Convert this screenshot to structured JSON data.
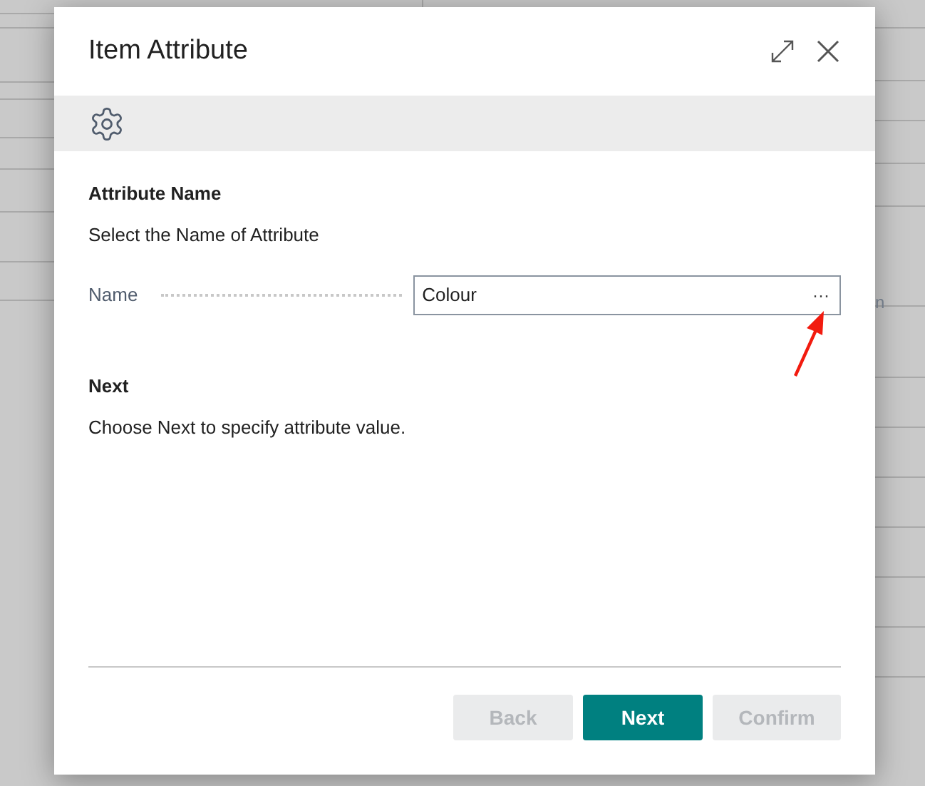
{
  "background_page": {
    "texts": [
      "n"
    ]
  },
  "dialog": {
    "title": "Item Attribute",
    "sections": [
      {
        "heading": "Attribute Name",
        "description": "Select the Name of Attribute"
      }
    ],
    "field": {
      "label": "Name",
      "value": "Colour",
      "assist": "···"
    },
    "next_section": {
      "heading": "Next",
      "description": "Choose Next to specify attribute value."
    },
    "buttons": [
      {
        "label": "Back",
        "kind": "secondary",
        "disabled": true
      },
      {
        "label": "Next",
        "kind": "primary",
        "disabled": false
      },
      {
        "label": "Confirm",
        "kind": "secondary",
        "disabled": true
      }
    ]
  }
}
